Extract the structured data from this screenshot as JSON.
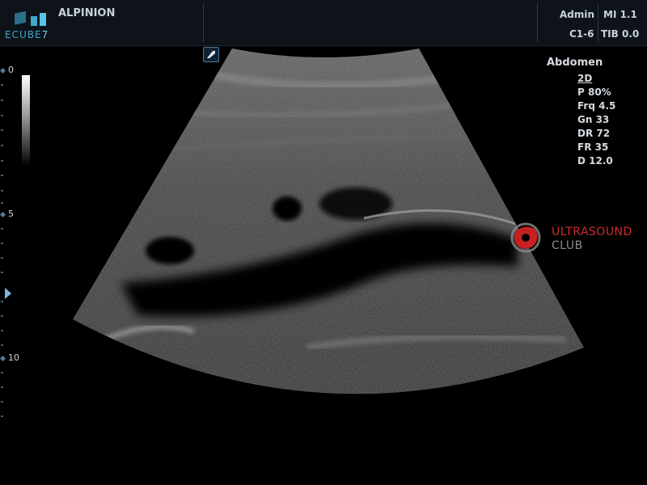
{
  "header": {
    "logo_text": "ECUBE",
    "logo_suffix": "7",
    "brand": "ALPINION",
    "user": "Admin",
    "mi": "MI 1.1",
    "probe": "C1-6",
    "tib": "TIB 0.0"
  },
  "depth_scale": {
    "labels": [
      "0",
      "5",
      "10"
    ]
  },
  "params": {
    "preset": "Abdomen",
    "mode": "2D",
    "power": "P 80%",
    "frequency": "Frq 4.5",
    "gain": "Gn 33",
    "dynamic_range": "DR 72",
    "frame_rate": "FR 35",
    "depth": "D 12.0"
  },
  "watermark": {
    "line1": "ULTRASOUND",
    "line2": "CLUB",
    "colors": {
      "primary": "#d12a2a",
      "secondary": "#8b8b8b"
    }
  },
  "icons": {
    "orientation": "orientation-marker-icon",
    "focus": "focus-triangle-icon"
  }
}
